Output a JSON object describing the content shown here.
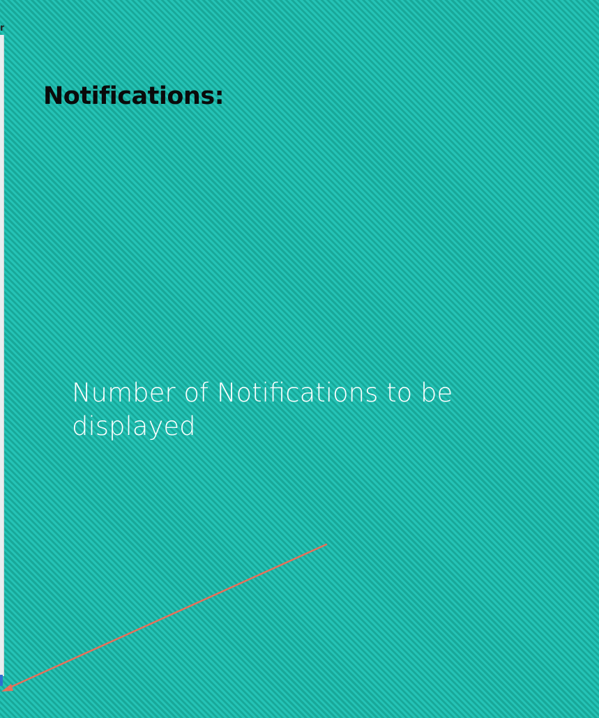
{
  "slide": {
    "title": "Notifications:",
    "callout_text": "Number of Notifications to be displayed",
    "edge_glyph": "n"
  },
  "colors": {
    "background": "#1fb6a8",
    "stripe_light": "#25c3b6",
    "stripe_dark": "#18a899",
    "title_text": "#0a0a0a",
    "callout_text": "#ffffff",
    "arrow": "#e8705a",
    "edge_marker": "#2f6fd1"
  },
  "annotation": {
    "arrow_icon": "callout-arrow-icon"
  }
}
